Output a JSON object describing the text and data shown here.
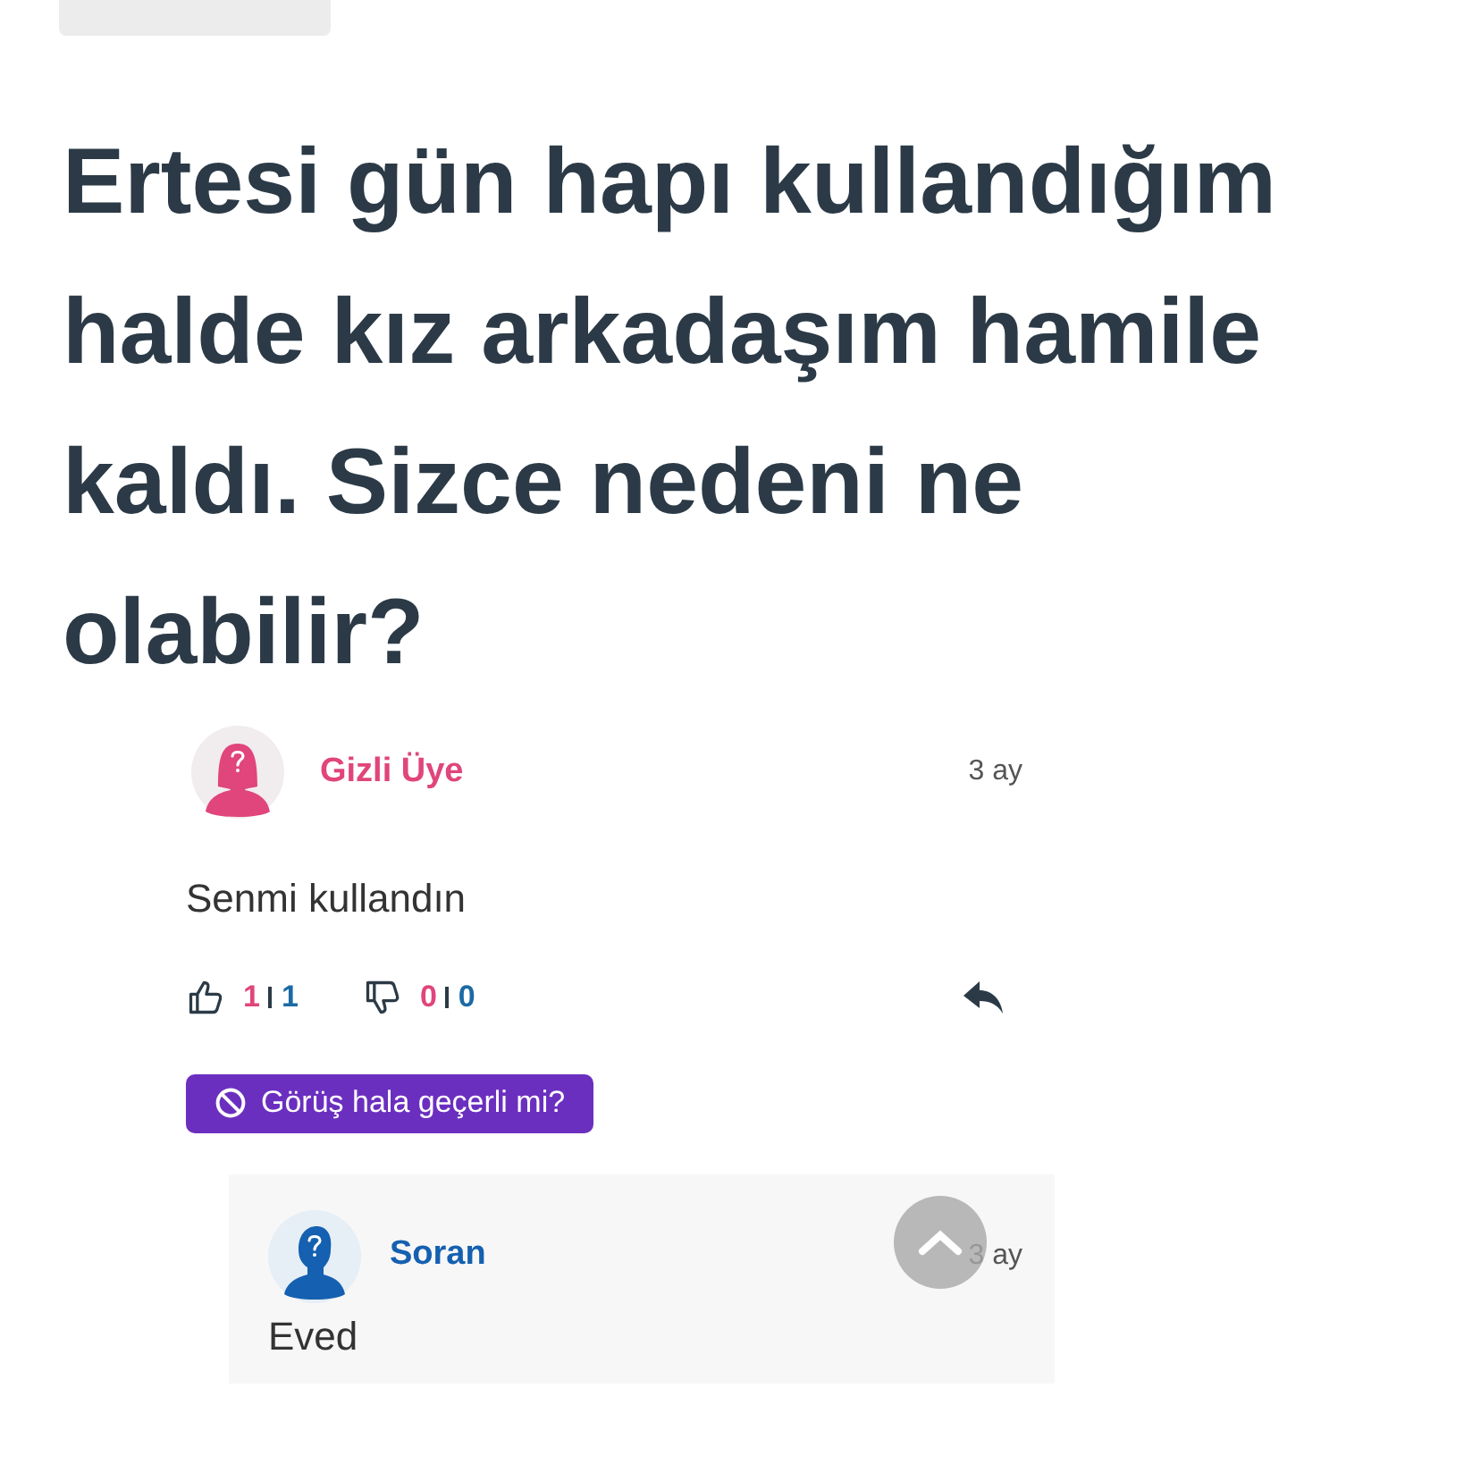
{
  "question": {
    "title": "Ertesi gün hapı kullandığım halde kız arkadaşım hamile kaldı. Sizce nedeni ne olabilir?"
  },
  "comment": {
    "author": "Gizli Üye",
    "color": "#e0457b",
    "time": "3 ay",
    "body": "Senmi kullandın",
    "likes": {
      "first": "1",
      "second": "1"
    },
    "dislikes": {
      "first": "0",
      "second": "0"
    },
    "flag_button": "Görüş hala geçerli mi?",
    "reply": {
      "author": "Soran",
      "color": "#1560b0",
      "time": "3 ay",
      "body": "Eved"
    }
  }
}
